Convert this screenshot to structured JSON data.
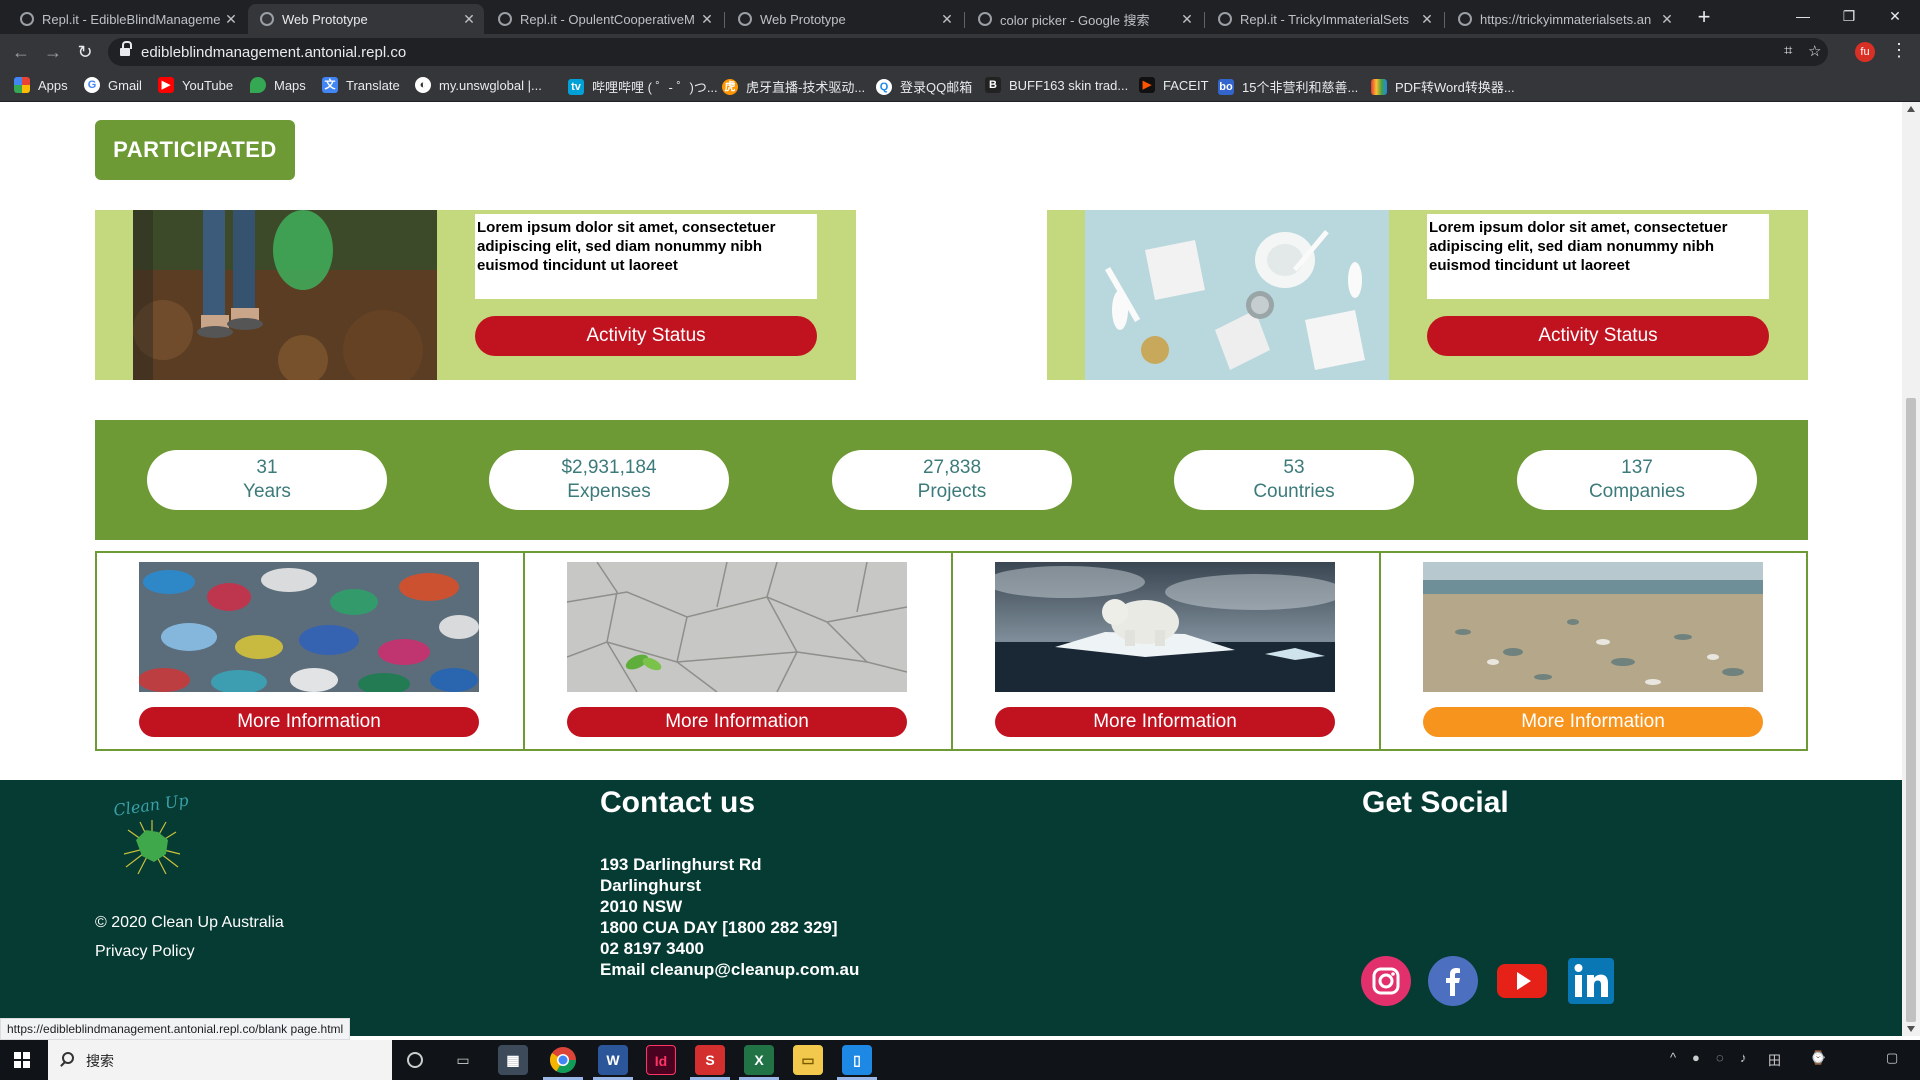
{
  "browser": {
    "tabs": [
      {
        "title": "Repl.it - EdibleBlindManageme",
        "active": false
      },
      {
        "title": "Web Prototype",
        "active": true
      },
      {
        "title": "Repl.it - OpulentCooperativeM",
        "active": false
      },
      {
        "title": "Web Prototype",
        "active": false
      },
      {
        "title": "color picker - Google 搜索",
        "active": false
      },
      {
        "title": "Repl.it - TrickyImmaterialSets",
        "active": false
      },
      {
        "title": "https://trickyimmaterialsets.an",
        "active": false
      }
    ],
    "url": "edibleblindmanagement.antonial.repl.co",
    "profile_initials": "fu",
    "bookmarks": [
      {
        "label": "Apps",
        "icon": "apps-grid-icon"
      },
      {
        "label": "Gmail",
        "icon": "google-icon"
      },
      {
        "label": "YouTube",
        "icon": "youtube-icon"
      },
      {
        "label": "Maps",
        "icon": "maps-icon"
      },
      {
        "label": "Translate",
        "icon": "translate-icon"
      },
      {
        "label": "my.unswglobal |...",
        "icon": "globe-icon"
      },
      {
        "label": "哔哩哔哩 ( ゜- ゜)つ...",
        "icon": "bilibili-icon"
      },
      {
        "label": "虎牙直播-技术驱动...",
        "icon": "huya-icon"
      },
      {
        "label": "登录QQ邮箱",
        "icon": "qq-icon"
      },
      {
        "label": "BUFF163 skin trad...",
        "icon": "buff-icon"
      },
      {
        "label": "FACEIT",
        "icon": "faceit-icon"
      },
      {
        "label": "15个非营利和慈善...",
        "icon": "bo-icon"
      },
      {
        "label": "PDF转Word转换器...",
        "icon": "pdf-icon"
      }
    ]
  },
  "page": {
    "participated_label": "PARTICIPATED",
    "activities": [
      {
        "text": "Lorem ipsum dolor sit amet, consectetuer adipiscing elit, sed diam nonummy nibh euismod tincidunt ut laoreet",
        "button": "Activity Status",
        "image": "forest-litter-pickup-photo"
      },
      {
        "text": "Lorem ipsum dolor sit amet, consectetuer adipiscing elit, sed diam nonummy nibh euismod tincidunt ut laoreet",
        "button": "Activity Status",
        "image": "plastic-items-photo"
      }
    ],
    "stats": [
      {
        "value": "31",
        "label": "Years"
      },
      {
        "value": "$2,931,184",
        "label": "Expenses"
      },
      {
        "value": "27,838",
        "label": "Projects"
      },
      {
        "value": "53",
        "label": "Countries"
      },
      {
        "value": "137",
        "label": "Companies"
      }
    ],
    "info_cards": [
      {
        "button": "More Information",
        "image": "plastic-bottles-photo",
        "hovered": false
      },
      {
        "button": "More Information",
        "image": "cracked-earth-photo",
        "hovered": false
      },
      {
        "button": "More Information",
        "image": "polar-bear-ice-photo",
        "hovered": false
      },
      {
        "button": "More Information",
        "image": "polluted-beach-photo",
        "hovered": true
      }
    ],
    "colors": {
      "green": "#6e9a35",
      "light_green": "#c4d87e",
      "red": "#c1121f",
      "orange": "#f7941d",
      "footer": "#063b33",
      "stat_text": "#3d7a7a"
    }
  },
  "footer": {
    "logo_text": "Clean Up",
    "copyright": "© 2020 Clean Up Australia",
    "privacy": "Privacy Policy",
    "contact_heading": "Contact us",
    "contact_lines": [
      "193 Darlinghurst Rd",
      "Darlinghurst",
      "2010 NSW",
      "1800 CUA DAY [1800 282 329]",
      "02 8197 3400",
      "Email cleanup@cleanup.com.au"
    ],
    "social_heading": "Get Social",
    "social": [
      "instagram-icon",
      "facebook-icon",
      "youtube-icon",
      "linkedin-icon"
    ]
  },
  "status_bar_url": "https://edibleblindmanagement.antonial.repl.co/blank page.html",
  "taskbar": {
    "search_placeholder": "搜索"
  }
}
